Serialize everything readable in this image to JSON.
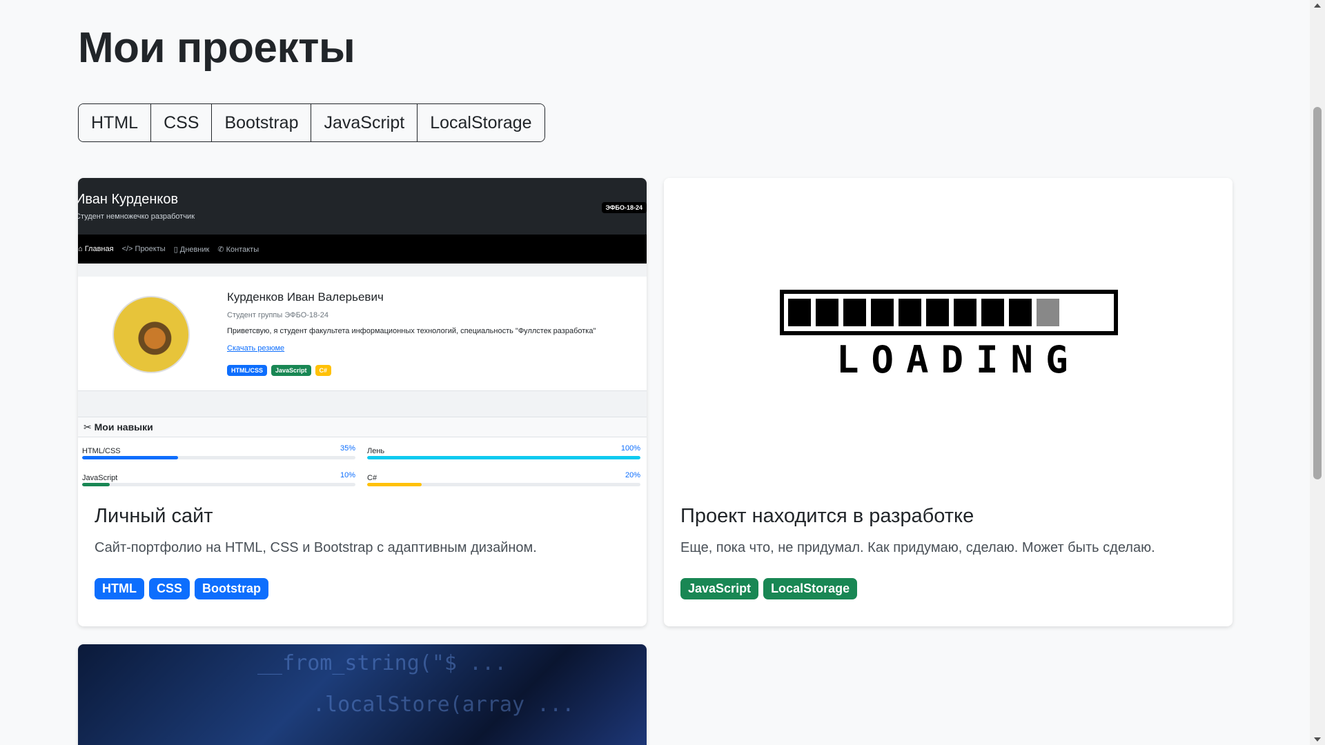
{
  "page": {
    "title": "Мои проекты"
  },
  "filters": [
    "HTML",
    "CSS",
    "Bootstrap",
    "JavaScript",
    "LocalStorage"
  ],
  "projects": [
    {
      "title": "Личный сайт",
      "description": "Сайт-портфолио на HTML, CSS и Bootstrap с адаптивным дизайном.",
      "tags": [
        "HTML",
        "CSS",
        "Bootstrap"
      ],
      "tag_color": "#0d6efd",
      "preview": {
        "name": "Иван Курденков",
        "subtitle": "Студент немножечко разработчик",
        "badge": "ЭФБО-18-24",
        "nav": [
          "⌂ Главная",
          "</> Проекты",
          "▯ Дневник",
          "✆ Контакты"
        ],
        "full_name": "Курденков Иван Валерьевич",
        "group": "Студент группы ЭФБО-18-24",
        "greeting": "Приветсвую, я студент факультета информационных технологий, специальность \"Фуллстек разработка\"",
        "resume_link": "Скачать резюме",
        "tags": [
          {
            "label": "HTML/CSS",
            "color": "#0d6efd"
          },
          {
            "label": "JavaScript",
            "color": "#198754"
          },
          {
            "label": "C#",
            "color": "#ffc107"
          }
        ],
        "skills_header": "Мои навыки",
        "skills": [
          {
            "label": "HTML/CSS",
            "percent": "35%",
            "value": 35,
            "color": "#0d6efd"
          },
          {
            "label": "Лень",
            "percent": "100%",
            "value": 100,
            "color": "#0dcaf0"
          },
          {
            "label": "JavaScript",
            "percent": "10%",
            "value": 10,
            "color": "#198754"
          },
          {
            "label": "C#",
            "percent": "20%",
            "value": 20,
            "color": "#ffc107"
          }
        ]
      }
    },
    {
      "title": "Проект находится в разработке",
      "description": "Еще, пока что, не придумал. Как придумаю, сделаю. Может быть сделаю.",
      "tags": [
        "JavaScript",
        "LocalStorage"
      ],
      "tag_color": "#198754",
      "loading_text": "LOADING",
      "loading_progress": 0.91
    }
  ]
}
